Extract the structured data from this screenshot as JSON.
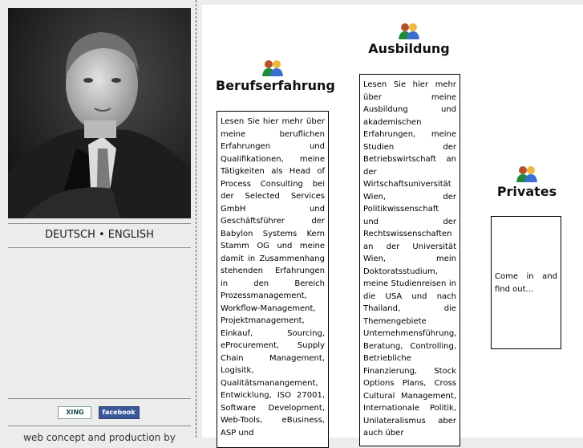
{
  "sidebar": {
    "language_links": "DEUTSCH • ENGLISH",
    "social": {
      "xing": "XING",
      "facebook": "facebook"
    },
    "credits": "web concept and production by"
  },
  "sections": {
    "berufserfahrung": {
      "title": "Berufserfahrung",
      "text": "Lesen Sie hier mehr über meine beruflichen Erfahrungen und Qualifikationen, meine Tätigkeiten als Head of Process Consulting bei der Selected Services GmbH und Geschäftsführer der Babylon Systems Kern Stamm OG und meine damit in Zusammenhang stehenden Erfahrungen in den Bereich Prozessmanagement, Workflow-Management, Projektmanagement, Einkauf, Sourcing, eProcurement, Supply Chain Management, Logisitk, Qualitätsmanangement, Entwicklung, ISO 27001, Software Development, Web-Tools, eBusiness, ASP und"
    },
    "ausbildung": {
      "title": "Ausbildung",
      "text": "Lesen Sie hier mehr über meine Ausbildung und akademischen Erfahrungen, meine Studien der Betriebswirtschaft an der Wirtschaftsuniversität Wien, der Politikwissenschaft und der Rechtswissenschaften an der Universität Wien, mein Doktoratsstudium, meine Studienreisen in die USA und nach Thailand, die Themengebiete Unternehmensführung, Beratung, Controlling, Betriebliche Finanzierung, Stock Options Plans, Cross Cultural Management, Internationale Politik, Unilateralismus aber auch über"
    },
    "privates": {
      "title": "Privates",
      "text": "Come in and find out..."
    }
  },
  "icons": {
    "people": "people-icon"
  },
  "colors": {
    "panel": "#ececec",
    "content": "#ffffff",
    "divider": "#8a8a8a"
  }
}
